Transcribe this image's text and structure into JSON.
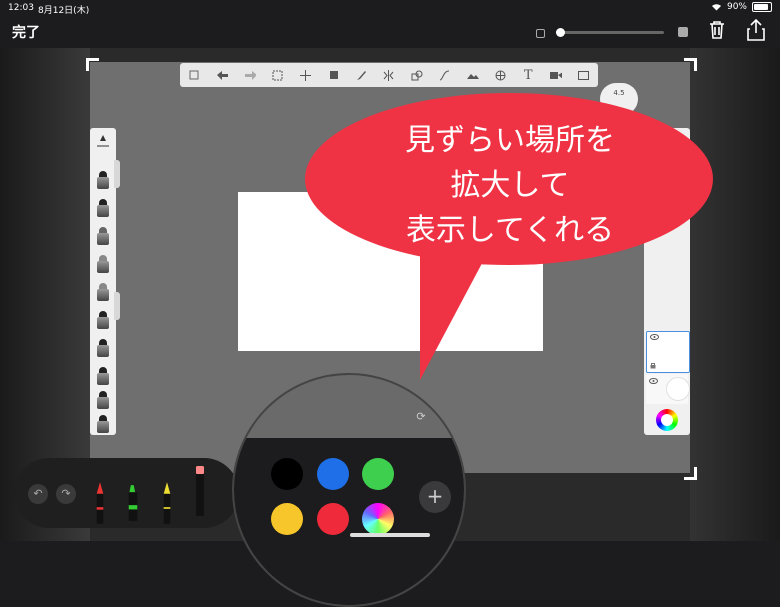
{
  "status_bar": {
    "time": "12:03",
    "date": "8月12日(木)",
    "battery": "90%"
  },
  "header": {
    "done_label": "完了",
    "brush_size_slider": 0.03
  },
  "toolbar": {
    "icons": [
      "gallery-icon",
      "undo-arrow-icon",
      "redo-arrow-icon",
      "selection-icon",
      "move-icon",
      "layers-icon",
      "pencil-icon",
      "symmetry-icon",
      "shapes-icon",
      "curve-icon",
      "image-icon",
      "perspective-icon",
      "text-icon",
      "video-icon",
      "fullscreen-icon"
    ],
    "text_tool_glyph": "T"
  },
  "size_knob": {
    "value": "4.5"
  },
  "callout": {
    "lines": [
      "見ずらい場所を",
      "拡大して",
      "表示してくれる"
    ]
  },
  "colors": {
    "swatches": [
      "#000000",
      "#1f6fe8",
      "#3fcf4f",
      "#f7c62a",
      "#ef2a3a",
      "wheel"
    ],
    "accent": "#ef3344"
  },
  "dock": {
    "undo_icon": "↶",
    "redo_icon": "↷"
  },
  "plus_label": "+"
}
